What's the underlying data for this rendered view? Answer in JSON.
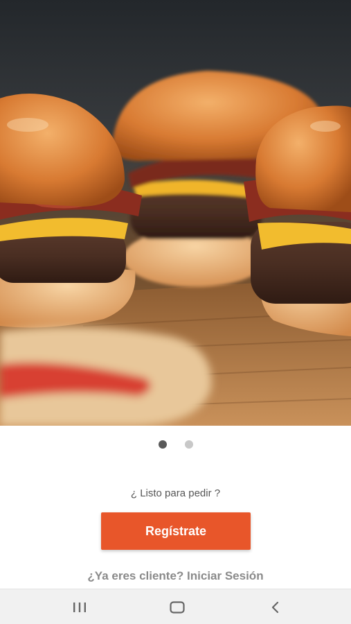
{
  "hero": {
    "icon": "burger-photo",
    "pager": {
      "total": 2,
      "active_index": 0
    }
  },
  "prompt_text": "¿ Listo para pedir ?",
  "register_button": {
    "label": "Regístrate",
    "color": "#e8562a"
  },
  "login_link": {
    "label": "¿Ya eres cliente? Iniciar Sesión"
  },
  "navbar": {
    "recent_icon": "recent-apps-icon",
    "home_icon": "home-icon",
    "back_icon": "back-icon"
  }
}
